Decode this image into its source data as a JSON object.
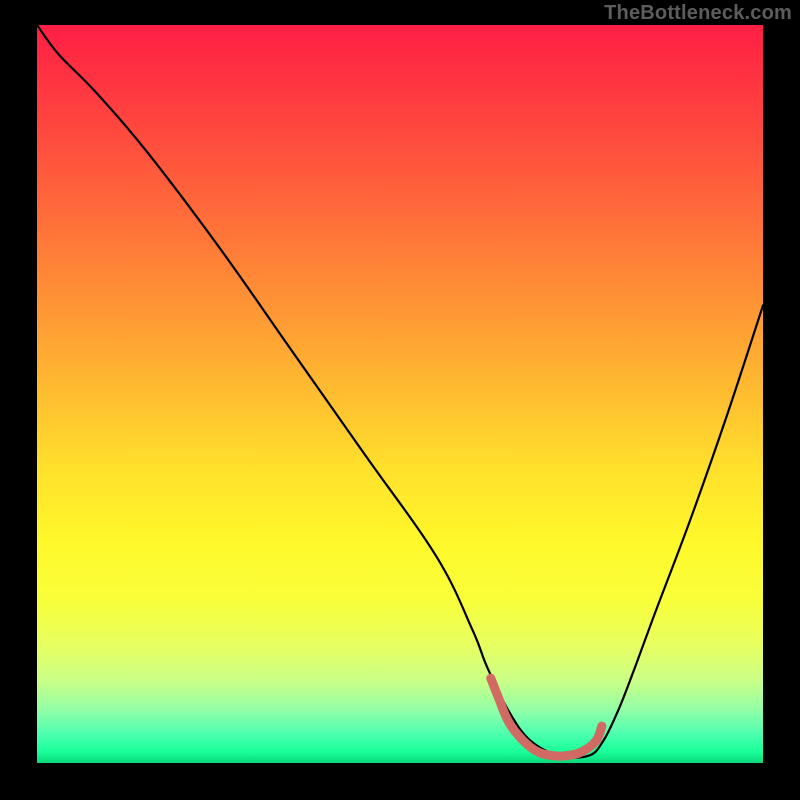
{
  "watermark": "TheBottleneck.com",
  "colors": {
    "curve": "#000000",
    "marker": "#d06a63",
    "frame_bg": "#000000"
  },
  "chart_data": {
    "type": "line",
    "title": "",
    "xlabel": "",
    "ylabel": "",
    "xlim": [
      0,
      100
    ],
    "ylim": [
      0,
      100
    ],
    "series": [
      {
        "name": "curve",
        "x": [
          0,
          3,
          8,
          15,
          25,
          35,
          45,
          55,
          60,
          62,
          65,
          68,
          72,
          76,
          78,
          80,
          82,
          85,
          90,
          95,
          100
        ],
        "y": [
          100,
          96,
          91,
          83,
          70,
          56,
          42,
          28,
          18,
          13,
          7,
          3,
          1,
          1,
          3,
          7,
          12,
          20,
          33,
          47,
          62
        ]
      }
    ],
    "marker_segment": {
      "name": "trough-highlight",
      "x": [
        62.5,
        63.5,
        65,
        67,
        69,
        71,
        73,
        75,
        77,
        77.8
      ],
      "y": [
        11.5,
        9,
        5.5,
        3,
        1.5,
        1,
        1,
        1.5,
        3,
        5
      ]
    }
  }
}
